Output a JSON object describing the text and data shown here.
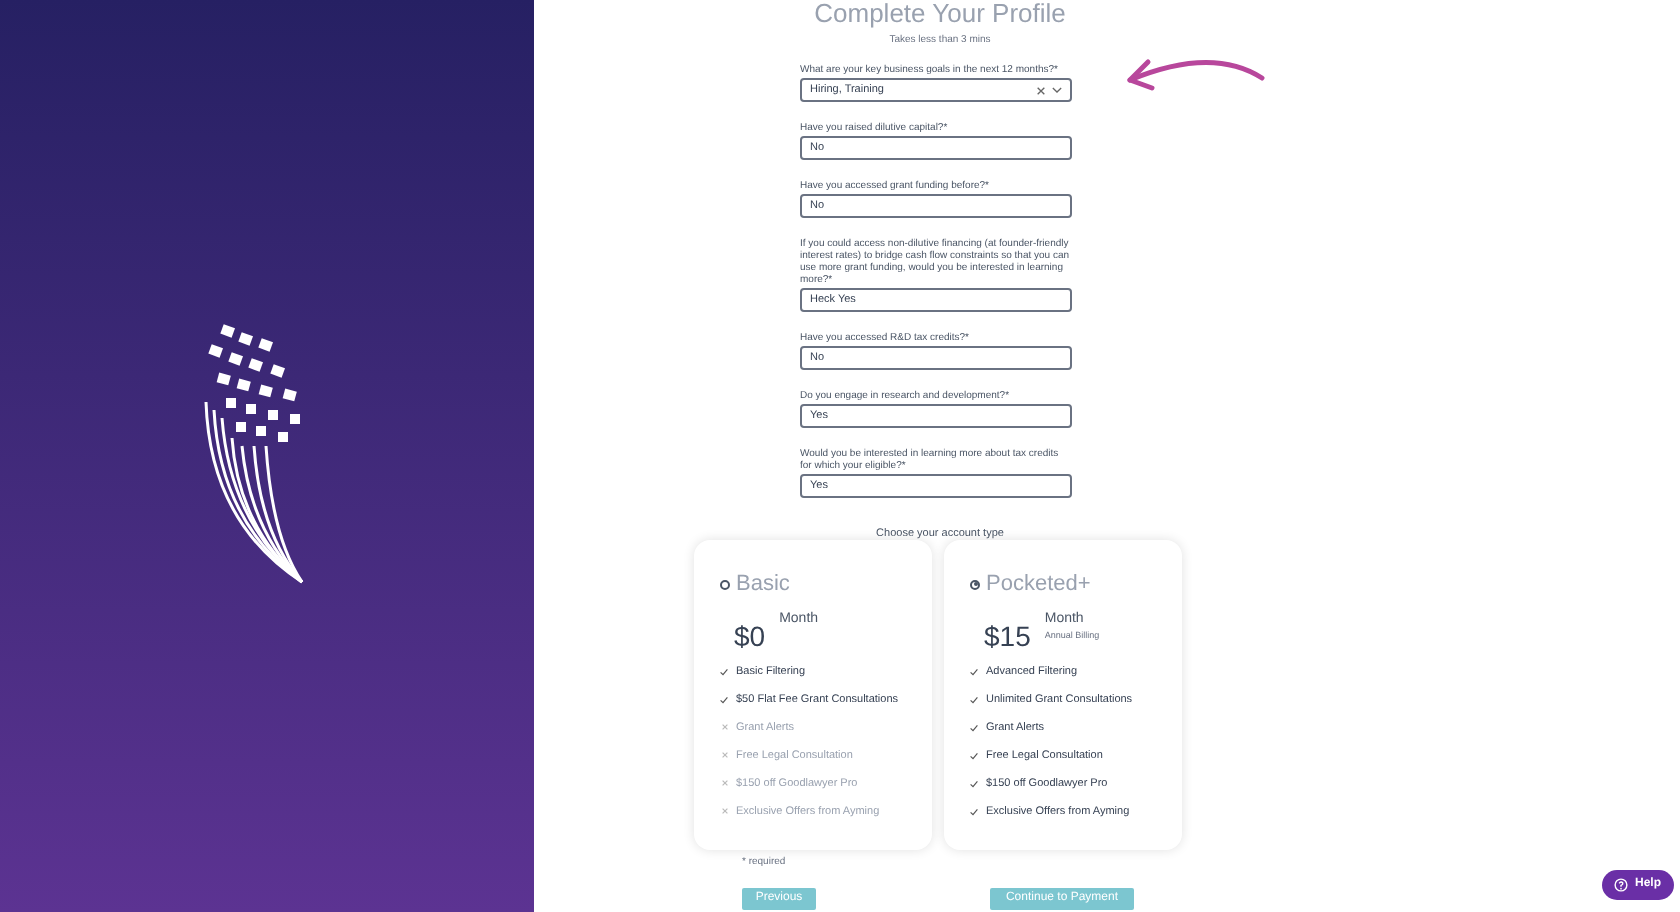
{
  "title": "Complete Your Profile",
  "subtitle": "Takes less than 3 mins",
  "questions": [
    {
      "kind": "multiselect",
      "label": "What are your key business goals in the next 12 months?*",
      "value": "Hiring, Training"
    },
    {
      "kind": "text",
      "label": "Have you raised dilutive capital?*",
      "value": "No"
    },
    {
      "kind": "text",
      "label": "Have you accessed grant funding before?*",
      "value": "No"
    },
    {
      "kind": "text",
      "label": "If you could access non-dilutive financing (at founder-friendly interest rates) to bridge cash flow constraints so that you can use more grant funding, would you be interested in learning more?*",
      "value": "Heck Yes"
    },
    {
      "kind": "text",
      "label": "Have you accessed R&D tax credits?*",
      "value": "No"
    },
    {
      "kind": "text",
      "label": "Do you engage in research and development?*",
      "value": "Yes"
    },
    {
      "kind": "text",
      "label": "Would you be interested in learning more about tax credits for which your eligible?*",
      "value": "Yes"
    }
  ],
  "account_prompt": "Choose your account type",
  "plans": [
    {
      "name": "Basic",
      "selected": false,
      "price": "$0",
      "period": "Month",
      "features": [
        {
          "label": "Basic Filtering",
          "included": true
        },
        {
          "label": "$50 Flat Fee Grant Consultations",
          "included": true
        },
        {
          "label": "Grant Alerts",
          "included": false
        },
        {
          "label": "Free Legal Consultation",
          "included": false
        },
        {
          "label": "$150 off Goodlawyer Pro",
          "included": false
        },
        {
          "label": "Exclusive Offers from Ayming",
          "included": false
        }
      ]
    },
    {
      "name": "Pocketed+",
      "selected": true,
      "price": "$15",
      "period": "Month",
      "billing": "Annual Billing",
      "features": [
        {
          "label": "Advanced Filtering",
          "included": true
        },
        {
          "label": "Unlimited Grant Consultations",
          "included": true
        },
        {
          "label": "Grant Alerts",
          "included": true
        },
        {
          "label": "Free Legal Consultation",
          "included": true
        },
        {
          "label": "$150 off Goodlawyer Pro",
          "included": true
        },
        {
          "label": "Exclusive Offers from Ayming",
          "included": true
        }
      ]
    }
  ],
  "required_note": "* required",
  "buttons": {
    "previous": "Previous",
    "continue": "Continue to Payment"
  },
  "help": "Help"
}
